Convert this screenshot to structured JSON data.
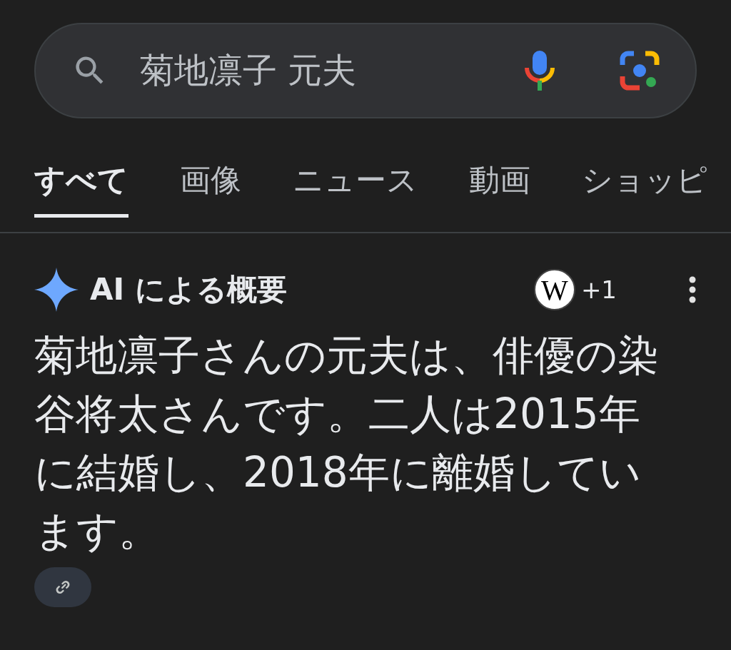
{
  "search": {
    "value": "菊地凛子 元夫"
  },
  "tabs": [
    {
      "label": "すべて",
      "selected": true
    },
    {
      "label": "画像",
      "selected": false
    },
    {
      "label": "ニュース",
      "selected": false
    },
    {
      "label": "動画",
      "selected": false
    },
    {
      "label": "ショッピ",
      "selected": false
    }
  ],
  "ai_overview": {
    "title": "AI による概要",
    "source_logo": "W",
    "source_count": "+1",
    "text": "菊地凛子さんの元夫は、俳優の染谷将太さんです。二人は2015年に結婚し、2018年に離婚しています。"
  }
}
